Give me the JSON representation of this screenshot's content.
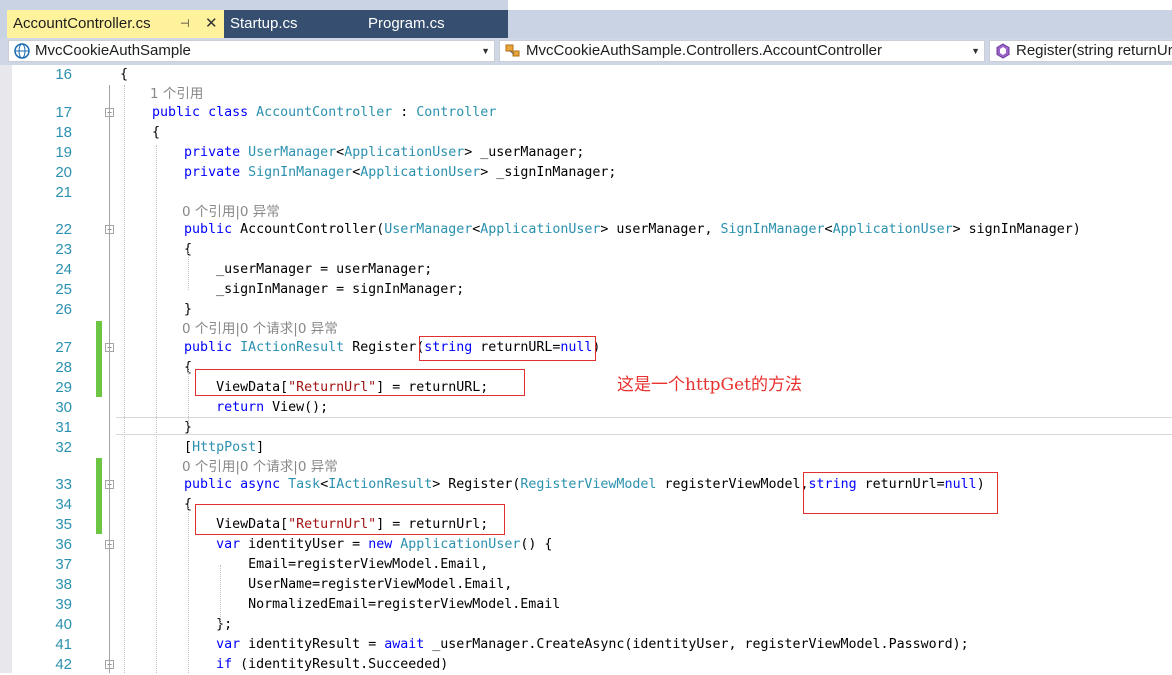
{
  "tabs": [
    {
      "label": "AccountController.cs",
      "active": true,
      "pin_glyph": "⊣",
      "close_glyph": "✕"
    },
    {
      "label": "Startup.cs",
      "active": false
    },
    {
      "label": "Program.cs",
      "active": false
    }
  ],
  "nav": {
    "project": "MvcCookieAuthSample",
    "class": "MvcCookieAuthSample.Controllers.AccountController",
    "member": "Register(string returnUrl"
  },
  "annotation": "这是一个httpGet的方法",
  "lines": [
    {
      "n": "16",
      "code": "{"
    },
    {
      "lens": "1 个引用"
    },
    {
      "n": "17",
      "html": "    <span class=\"kw\">public</span> <span class=\"kw\">class</span> <span class=\"ty\">AccountController</span> : <span class=\"ty\">Controller</span>"
    },
    {
      "n": "18",
      "code": "    {"
    },
    {
      "n": "19",
      "html": "        <span class=\"kw\">private</span> <span class=\"ty\">UserManager</span>&lt;<span class=\"ty\">ApplicationUser</span>&gt; _userManager;"
    },
    {
      "n": "20",
      "html": "        <span class=\"kw\">private</span> <span class=\"ty\">SignInManager</span>&lt;<span class=\"ty\">ApplicationUser</span>&gt; _signInManager;"
    },
    {
      "n": "21",
      "code": ""
    },
    {
      "lens": "0 个引用|0 异常"
    },
    {
      "n": "22",
      "html": "        <span class=\"kw\">public</span> AccountController(<span class=\"ty\">UserManager</span>&lt;<span class=\"ty\">ApplicationUser</span>&gt; userManager, <span class=\"ty\">SignInManager</span>&lt;<span class=\"ty\">ApplicationUser</span>&gt; signInManager)"
    },
    {
      "n": "23",
      "code": "        {"
    },
    {
      "n": "24",
      "code": "            _userManager = userManager;"
    },
    {
      "n": "25",
      "code": "            _signInManager = signInManager;"
    },
    {
      "n": "26",
      "code": "        }"
    },
    {
      "lens": "0 个引用|0 个请求|0 异常"
    },
    {
      "n": "27",
      "html": "        <span class=\"kw\">public</span> <span class=\"ty\">IActionResult</span> Register(<span class=\"kw\">string</span> returnURL=<span class=\"kw\">null</span>)"
    },
    {
      "n": "28",
      "code": "        {"
    },
    {
      "n": "29",
      "html": "            ViewData[<span class=\"st\">\"ReturnUrl\"</span>] = returnURL;"
    },
    {
      "n": "30",
      "html": "            <span class=\"kw\">return</span> View();"
    },
    {
      "n": "31",
      "code": "        }"
    },
    {
      "n": "32",
      "html": "        [<span class=\"ty\">HttpPost</span>]"
    },
    {
      "lens": "0 个引用|0 个请求|0 异常"
    },
    {
      "n": "33",
      "html": "        <span class=\"kw\">public</span> <span class=\"kw\">async</span> <span class=\"ty\">Task</span>&lt;<span class=\"ty\">IActionResult</span>&gt; Register(<span class=\"ty\">RegisterViewModel</span> registerViewModel,<span class=\"kw\">string</span> returnUrl=<span class=\"kw\">null</span>)"
    },
    {
      "n": "34",
      "code": "        {"
    },
    {
      "n": "35",
      "html": "            ViewData[<span class=\"st\">\"ReturnUrl\"</span>] = returnUrl;"
    },
    {
      "n": "36",
      "html": "            <span class=\"kw\">var</span> identityUser = <span class=\"kw\">new</span> <span class=\"ty\">ApplicationUser</span>() {"
    },
    {
      "n": "37",
      "code": "                Email=registerViewModel.Email,"
    },
    {
      "n": "38",
      "code": "                UserName=registerViewModel.Email,"
    },
    {
      "n": "39",
      "code": "                NormalizedEmail=registerViewModel.Email"
    },
    {
      "n": "40",
      "code": "            };"
    },
    {
      "n": "41",
      "html": "            <span class=\"kw\">var</span> identityResult = <span class=\"kw\">await</span> _userManager.CreateAsync(identityUser, registerViewModel.Password);"
    },
    {
      "n": "42",
      "html": "            <span class=\"kw\">if</span> (identityResult.Succeeded)"
    }
  ]
}
